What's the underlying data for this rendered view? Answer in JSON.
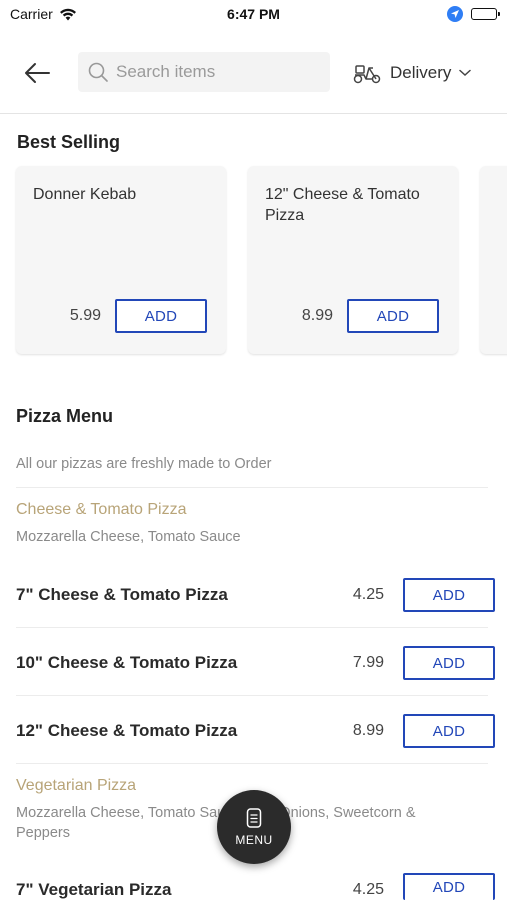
{
  "status_bar": {
    "carrier": "Carrier",
    "time": "6:47 PM"
  },
  "header": {
    "search_placeholder": "Search items",
    "delivery_label": "Delivery"
  },
  "best_selling": {
    "title": "Best Selling",
    "items": [
      {
        "name": "Donner Kebab",
        "price": "5.99",
        "add_label": "ADD"
      },
      {
        "name": "12\" Cheese & Tomato Pizza",
        "price": "8.99",
        "add_label": "ADD"
      }
    ]
  },
  "pizza_menu": {
    "title": "Pizza Menu",
    "description": "All our pizzas are freshly made to Order",
    "groups": [
      {
        "title": "Cheese & Tomato Pizza",
        "description": "Mozzarella Cheese, Tomato Sauce",
        "items": [
          {
            "name": "7\" Cheese & Tomato Pizza",
            "price": "4.25",
            "add_label": "ADD"
          },
          {
            "name": "10\" Cheese & Tomato Pizza",
            "price": "7.99",
            "add_label": "ADD"
          },
          {
            "name": "12\" Cheese & Tomato Pizza",
            "price": "8.99",
            "add_label": "ADD"
          }
        ]
      },
      {
        "title": "Vegetarian Pizza",
        "description": "Mozzarella Cheese, Tomato Sauce, Red Onions, Sweetcorn & Peppers",
        "items": [
          {
            "name": "7\" Vegetarian Pizza",
            "price": "4.25",
            "add_label": "ADD"
          }
        ]
      }
    ]
  },
  "fab": {
    "label": "MENU"
  },
  "colors": {
    "accent": "#2247b8",
    "group_title": "#b8a478",
    "fab_bg": "#2b2b2b"
  }
}
